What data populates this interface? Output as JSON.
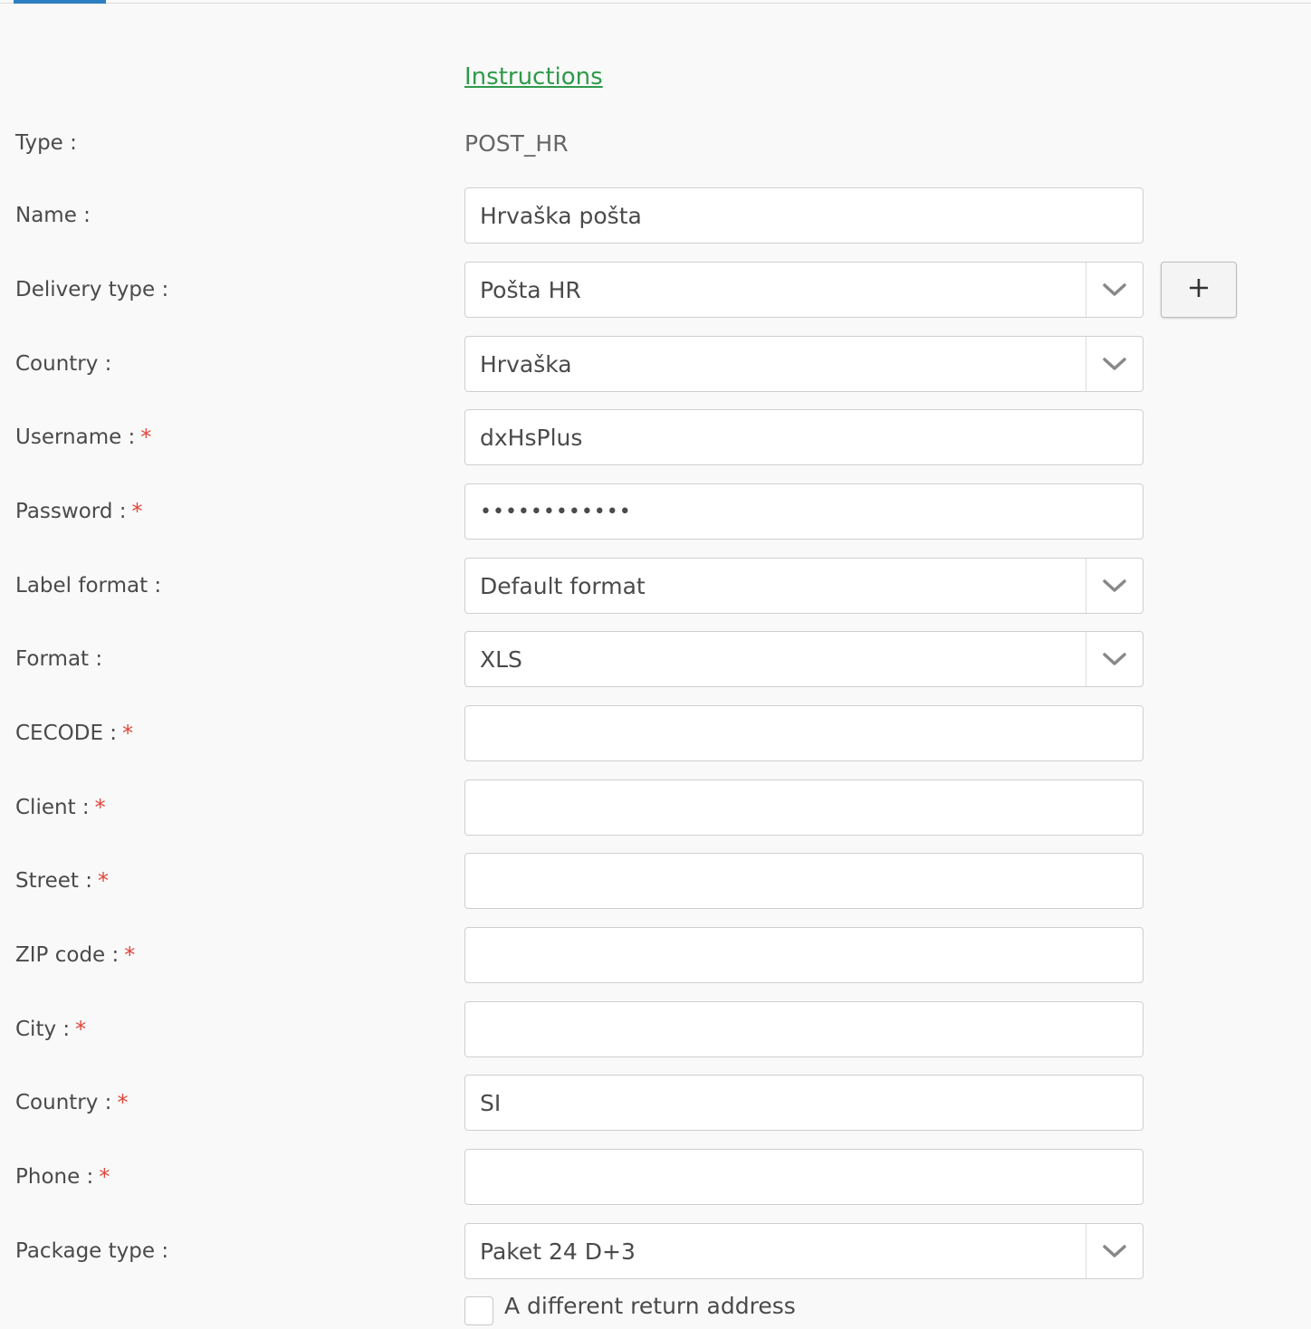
{
  "instructions_link": "Instructions",
  "fields": {
    "type": {
      "label": "Type :",
      "value": "POST_HR"
    },
    "name": {
      "label": "Name :",
      "value": "Hrvaška pošta"
    },
    "delivery_type": {
      "label": "Delivery type :",
      "value": "Pošta HR",
      "add_label": "+"
    },
    "country_select": {
      "label": "Country :",
      "value": "Hrvaška"
    },
    "username": {
      "label": "Username :",
      "value": "dxHsPlus",
      "required_mark": "*"
    },
    "password": {
      "label": "Password :",
      "value": "••••••••••••",
      "required_mark": "*"
    },
    "label_format": {
      "label": "Label format :",
      "value": "Default format"
    },
    "format": {
      "label": "Format :",
      "value": "XLS"
    },
    "cecode": {
      "label": "CECODE :",
      "value": "",
      "required_mark": "*"
    },
    "client": {
      "label": "Client :",
      "value": "",
      "required_mark": "*"
    },
    "street": {
      "label": "Street :",
      "value": "",
      "required_mark": "*"
    },
    "zip": {
      "label": "ZIP code :",
      "value": "",
      "required_mark": "*"
    },
    "city": {
      "label": "City :",
      "value": "",
      "required_mark": "*"
    },
    "country_text": {
      "label": "Country :",
      "value": "SI",
      "required_mark": "*"
    },
    "phone": {
      "label": "Phone :",
      "value": "",
      "required_mark": "*"
    },
    "package_type": {
      "label": "Package type :",
      "value": "Paket 24 D+3"
    }
  },
  "return_address_checkbox": {
    "label": "A different return address",
    "checked": false
  },
  "icons": {
    "select_arrow": "chevron-down-icon",
    "add": "plus-icon"
  },
  "colors": {
    "link": "#2f9a4a",
    "required": "#e2463a",
    "tab_accent": "#2d7fc1"
  }
}
